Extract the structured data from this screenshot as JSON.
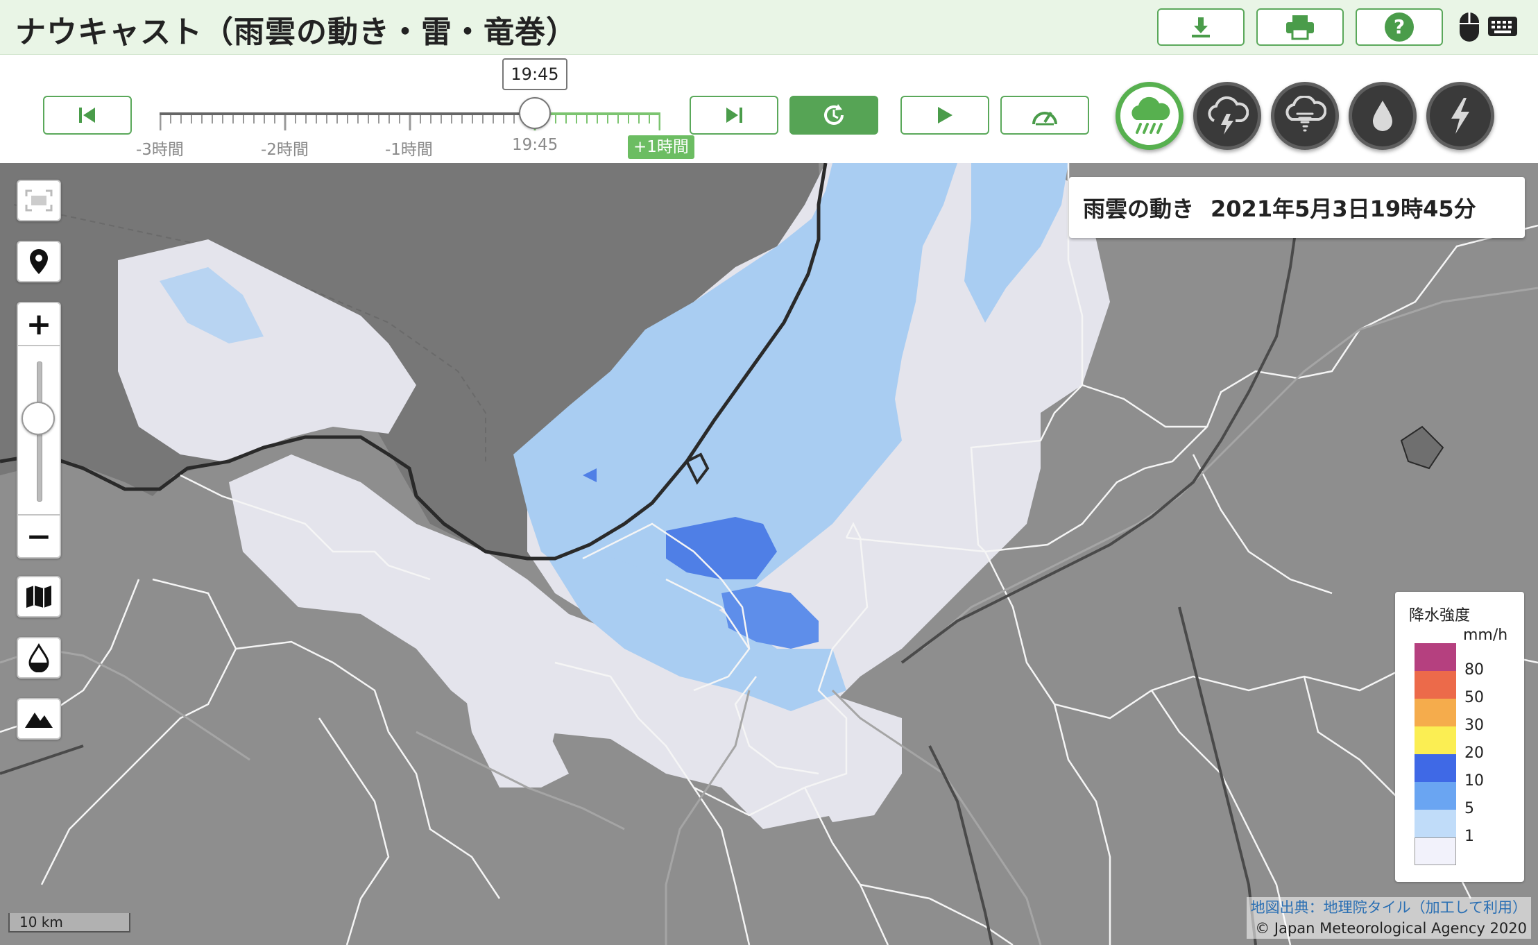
{
  "header": {
    "title": "ナウキャスト（雨雲の動き・雷・竜巻）",
    "download_icon": "download-icon",
    "print_icon": "printer-icon",
    "help_icon": "question-icon",
    "mouse_icon": "mouse-icon",
    "keyboard_icon": "keyboard-icon"
  },
  "timeline": {
    "tooltip": "19:45",
    "labels": [
      "-3時間",
      "-2時間",
      "-1時間",
      "19:45",
      "+1時間"
    ],
    "position_fraction": 0.75,
    "buttons": {
      "first_icon": "skip-to-start-icon",
      "last_icon": "skip-to-end-icon",
      "latest_icon": "refresh-latest-icon",
      "play_icon": "play-icon",
      "speed_icon": "speedometer-icon"
    }
  },
  "modes": [
    {
      "name": "rain-clouds",
      "icon": "rain-cloud-icon",
      "selected": true
    },
    {
      "name": "thunder",
      "icon": "thunder-cloud-icon",
      "selected": false
    },
    {
      "name": "tornado",
      "icon": "tornado-cloud-icon",
      "selected": false
    },
    {
      "name": "rainfall",
      "icon": "water-drop-icon",
      "selected": false
    },
    {
      "name": "lightning",
      "icon": "lightning-icon",
      "selected": false
    }
  ],
  "map": {
    "datetime_label": "雨雲の動き",
    "datetime_value": "2021年5月3日19時45分",
    "zoom_level_fraction": 0.5,
    "controls": [
      "fullscreen-icon",
      "location-pin-icon",
      "map-layer-icon",
      "drop-layer-icon",
      "mountain-icon"
    ],
    "scale_label": "10 km",
    "attribution_map": "地図出典：地理院タイル（加工して利用）",
    "attribution_jma": "© Japan Meteorological Agency 2020"
  },
  "legend": {
    "title": "降水強度",
    "unit": "mm/h",
    "items": [
      {
        "value": "80",
        "color": "#b5407f"
      },
      {
        "value": "50",
        "color": "#ec6a4a"
      },
      {
        "value": "30",
        "color": "#f5ac4c"
      },
      {
        "value": "20",
        "color": "#fbee53"
      },
      {
        "value": "10",
        "color": "#3f69e6"
      },
      {
        "value": "5",
        "color": "#6aa5f2"
      },
      {
        "value": "1",
        "color": "#c0dcf9"
      },
      {
        "value": "",
        "color": "#f2f2fb"
      }
    ]
  },
  "colors": {
    "accent": "#56a455",
    "sea": "#7a7a7a",
    "land": "#8f8f8f",
    "rain_light": "#e6e6f0"
  }
}
